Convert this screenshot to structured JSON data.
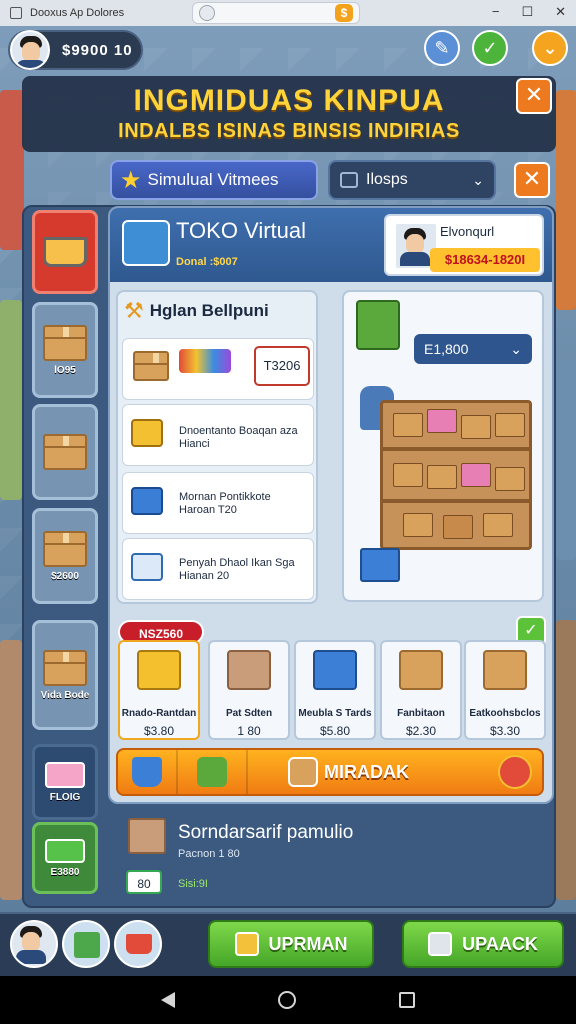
{
  "status_bar": {
    "app_title": "Dooxus Ap Dolores",
    "coin_glyph": "$",
    "window_controls": [
      "−",
      "☐",
      "✕"
    ]
  },
  "hud": {
    "money": "$9900  10",
    "icons": [
      "pencil-icon",
      "check-icon",
      "chevron-down-icon"
    ]
  },
  "banner": {
    "title": "INGMIDUAS KINPUA",
    "subtitle": "INDALBS ISINAS BINSIS INDIRIAS",
    "close": "✕"
  },
  "filters": {
    "sim_button": "Simulual Vitmees",
    "dropdown_value": "Ilosps",
    "close": "✕"
  },
  "sidebar": {
    "items": [
      {
        "label": ""
      },
      {
        "label": "lO95"
      },
      {
        "label": ""
      },
      {
        "label": "$2600"
      },
      {
        "label": "Vida Bode"
      },
      {
        "label": "FLOIG"
      },
      {
        "label": "E3880"
      }
    ]
  },
  "store": {
    "title": "TOKO Virtual",
    "subtitle": "Donal :$007",
    "owner_name": "Elvonqurl",
    "owner_balance": "$18634-1820I"
  },
  "inventory": {
    "heading": "Hglan Bellpuni",
    "price_value": "T3206",
    "rows": [
      {
        "line1": "",
        "line2": ""
      },
      {
        "line1": "Dnoentanto Boaqan aza",
        "line2": "Hianci"
      },
      {
        "line1": "Mornan Pontikkote",
        "line2": "Haroan  T20"
      },
      {
        "line1": "Penyah Dhaol Ikan Sga",
        "line2": "Hianan  20"
      }
    ]
  },
  "warehouse": {
    "price_select": "E1,800",
    "chevron": "⌄"
  },
  "sale_tag": "NSZ560",
  "check": "✓",
  "products": [
    {
      "name": "Rnado-Rantdan",
      "price": "$3.80",
      "color": "#f4c02e"
    },
    {
      "name": "Pat Sdten",
      "price": "1 80",
      "color": "#c99d7a"
    },
    {
      "name": "Meubla S Tards",
      "price": "$5.80",
      "color": "#3b7fd6"
    },
    {
      "name": "Fanbitaon",
      "price": "$2.30",
      "color": "#d9a25c"
    },
    {
      "name": "Eatkoohsbclos",
      "price": "$3.30",
      "color": "#d9a25c"
    }
  ],
  "action_bar": {
    "label": "MIRADAK"
  },
  "notice": {
    "title": "Sorndarsarif pamulio",
    "subtitle": "Pacnon  1 80",
    "chip": "80",
    "count": "Sisi:9I"
  },
  "bottom": {
    "btn_left": "UPRMAN",
    "btn_right": "UPAACK"
  },
  "colors": {
    "accent": "#ffd33a",
    "primary": "#3f6fae",
    "success": "#5cc23a",
    "warning": "#ee7a1f"
  }
}
